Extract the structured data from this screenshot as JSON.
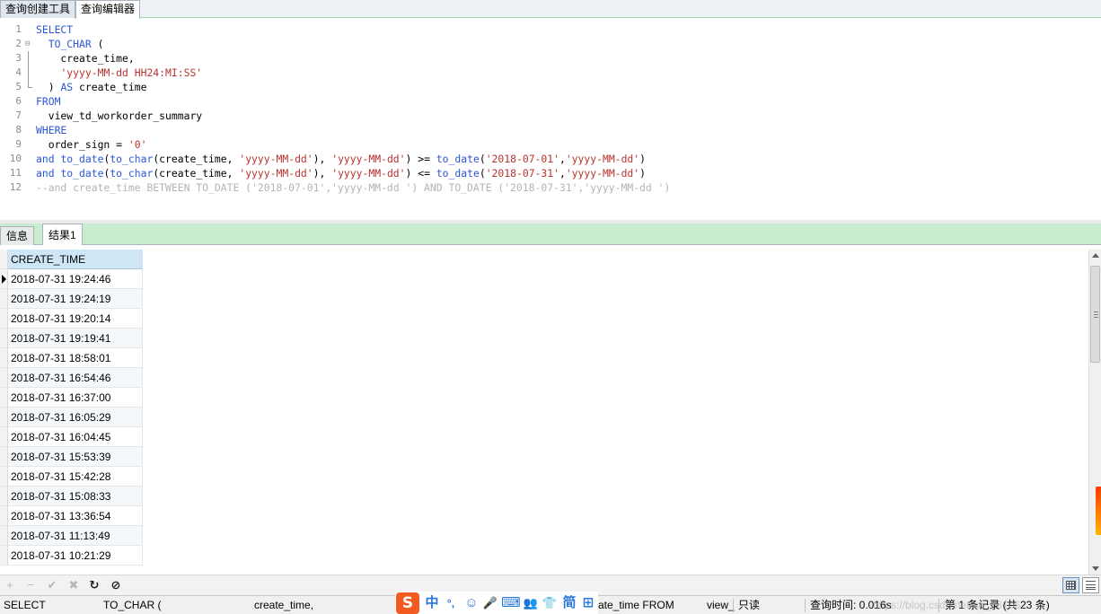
{
  "top_tabs": [
    "查询创建工具",
    "查询编辑器"
  ],
  "editor": {
    "line_numbers": [
      "1",
      "2",
      "3",
      "4",
      "5",
      "6",
      "7",
      "8",
      "9",
      "10",
      "11",
      "12"
    ],
    "lines": [
      [
        {
          "t": "SELECT",
          "c": "kw"
        }
      ],
      [
        {
          "t": "  "
        },
        {
          "t": "TO_CHAR",
          "c": "fn"
        },
        {
          "t": " ("
        }
      ],
      [
        {
          "t": "    create_time,"
        }
      ],
      [
        {
          "t": "    "
        },
        {
          "t": "'yyyy-MM-dd HH24:MI:SS'",
          "c": "str"
        }
      ],
      [
        {
          "t": "  ) "
        },
        {
          "t": "AS",
          "c": "kw"
        },
        {
          "t": " create_time"
        }
      ],
      [
        {
          "t": "FROM",
          "c": "kw"
        }
      ],
      [
        {
          "t": "  view_td_workorder_summary"
        }
      ],
      [
        {
          "t": "WHERE",
          "c": "kw"
        }
      ],
      [
        {
          "t": "  order_sign = "
        },
        {
          "t": "'0'",
          "c": "str"
        }
      ],
      [
        {
          "t": "and",
          "c": "kw"
        },
        {
          "t": " "
        },
        {
          "t": "to_date",
          "c": "fn"
        },
        {
          "t": "("
        },
        {
          "t": "to_char",
          "c": "fn"
        },
        {
          "t": "(create_time, "
        },
        {
          "t": "'yyyy-MM-dd'",
          "c": "str"
        },
        {
          "t": "), "
        },
        {
          "t": "'yyyy-MM-dd'",
          "c": "str"
        },
        {
          "t": ") >= "
        },
        {
          "t": "to_date",
          "c": "fn"
        },
        {
          "t": "("
        },
        {
          "t": "'2018-07-01'",
          "c": "str"
        },
        {
          "t": ","
        },
        {
          "t": "'yyyy-MM-dd'",
          "c": "str"
        },
        {
          "t": ")"
        }
      ],
      [
        {
          "t": "and",
          "c": "kw"
        },
        {
          "t": " "
        },
        {
          "t": "to_date",
          "c": "fn"
        },
        {
          "t": "("
        },
        {
          "t": "to_char",
          "c": "fn"
        },
        {
          "t": "(create_time, "
        },
        {
          "t": "'yyyy-MM-dd'",
          "c": "str"
        },
        {
          "t": "), "
        },
        {
          "t": "'yyyy-MM-dd'",
          "c": "str"
        },
        {
          "t": ") <= "
        },
        {
          "t": "to_date",
          "c": "fn"
        },
        {
          "t": "("
        },
        {
          "t": "'2018-07-31'",
          "c": "str"
        },
        {
          "t": ","
        },
        {
          "t": "'yyyy-MM-dd'",
          "c": "str"
        },
        {
          "t": ")"
        }
      ],
      [
        {
          "t": "--and create_time BETWEEN TO_DATE ('2018-07-01','yyyy-MM-dd ') AND TO_DATE ('2018-07-31','yyyy-MM-dd ')",
          "c": "cm"
        }
      ]
    ]
  },
  "result_tabs": [
    "信息",
    "结果1"
  ],
  "grid": {
    "column": "CREATE_TIME",
    "rows": [
      "2018-07-31 19:24:46",
      "2018-07-31 19:24:19",
      "2018-07-31 19:20:14",
      "2018-07-31 19:19:41",
      "2018-07-31 18:58:01",
      "2018-07-31 16:54:46",
      "2018-07-31 16:37:00",
      "2018-07-31 16:05:29",
      "2018-07-31 16:04:45",
      "2018-07-31 15:53:39",
      "2018-07-31 15:42:28",
      "2018-07-31 15:08:33",
      "2018-07-31 13:36:54",
      "2018-07-31 11:13:49",
      "2018-07-31 10:21:29"
    ]
  },
  "toolbar": {
    "add": "+",
    "remove": "−",
    "apply": "✔",
    "discard": "✖",
    "refresh": "↻",
    "stop": "⊘"
  },
  "status": {
    "sql_parts": [
      "SELECT",
      "TO_CHAR (",
      "create_time,",
      "ate_time FROM",
      "view_"
    ],
    "readonly": "只读",
    "query_time": "查询时间: 0.016s",
    "record": "第 1 条记录 (共 23 条)"
  },
  "ime": {
    "logo": "S",
    "items": [
      "中",
      "°,",
      "☺",
      "🎤",
      "⌨",
      "👥",
      "👕",
      "简",
      "⊞"
    ]
  },
  "watermark": "https://blog.csdn.net/qq_26106…"
}
